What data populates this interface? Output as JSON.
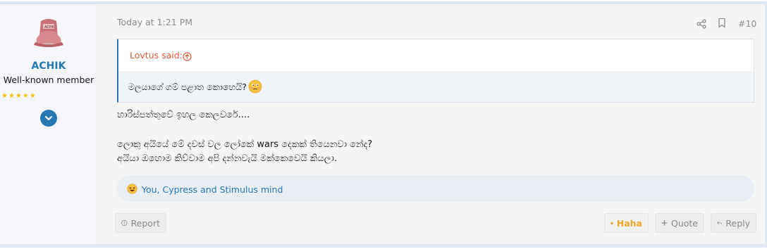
{
  "user": {
    "name": "ACHIK",
    "title": "Well-known member",
    "stars": "★★★★★",
    "avatar_icon": "bucket-hat-avatar"
  },
  "post": {
    "timestamp": "Today at 1:21 PM",
    "number": "#10",
    "share_icon": "share-icon",
    "bookmark_icon": "bookmark-icon"
  },
  "quote": {
    "author": "Lovtus said:",
    "text": "මලයාගේ ගම් පළාත කොහෙයි?",
    "emoji": "thinking-emoji"
  },
  "message": {
    "line1": "හාරිස්පත්තුවේ ඉහල කෙලවරේ....",
    "line2": "ලොකු අයියේ මේ දවස් වල ලෝකේ wars දෙකක් තියෙනවා නේද?",
    "line3": "අයියා ඔහොම කිව්වාම අපි දන්නවැයි මක්කෙවෙයි කියලා."
  },
  "reactions": {
    "summary": "You, Cypress and Stimulus mind"
  },
  "actions": {
    "report": "Report",
    "haha": "Haha",
    "quote": "Quote",
    "reply": "Reply"
  },
  "colors": {
    "accent": "#2577b1",
    "quote_author": "#e05b3b",
    "haha": "#f1a726",
    "star": "#f1c40f"
  }
}
